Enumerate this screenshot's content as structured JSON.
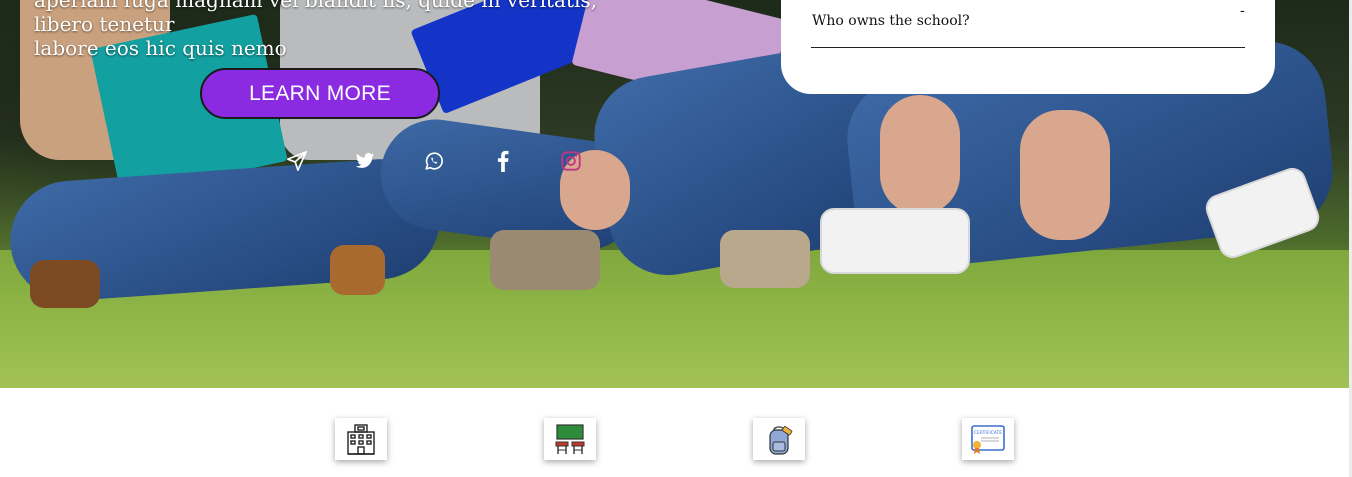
{
  "hero": {
    "text_line1": "aperiam fuga magnam vel blandit iis, quide in veritatis, libero tenetur",
    "text_line2": "labore eos hic quis nemo",
    "cta_label": "LEARN MORE"
  },
  "social": [
    {
      "name": "telegram-icon",
      "color": "#ffffff"
    },
    {
      "name": "twitter-icon",
      "color": "#ffffff"
    },
    {
      "name": "whatsapp-icon",
      "color": "#ffffff"
    },
    {
      "name": "facebook-icon",
      "color": "#ffffff"
    },
    {
      "name": "instagram-icon",
      "color": "#c13584"
    }
  ],
  "faq": {
    "question": "Who owns the school?",
    "toggle": "-"
  },
  "features": [
    {
      "icon": "school-building-icon"
    },
    {
      "icon": "classroom-icon"
    },
    {
      "icon": "school-bag-icon"
    },
    {
      "icon": "certificate-icon",
      "label": "CERTIFICATE"
    }
  ],
  "colors": {
    "accent": "#8a2be2",
    "instagram": "#c13584"
  }
}
